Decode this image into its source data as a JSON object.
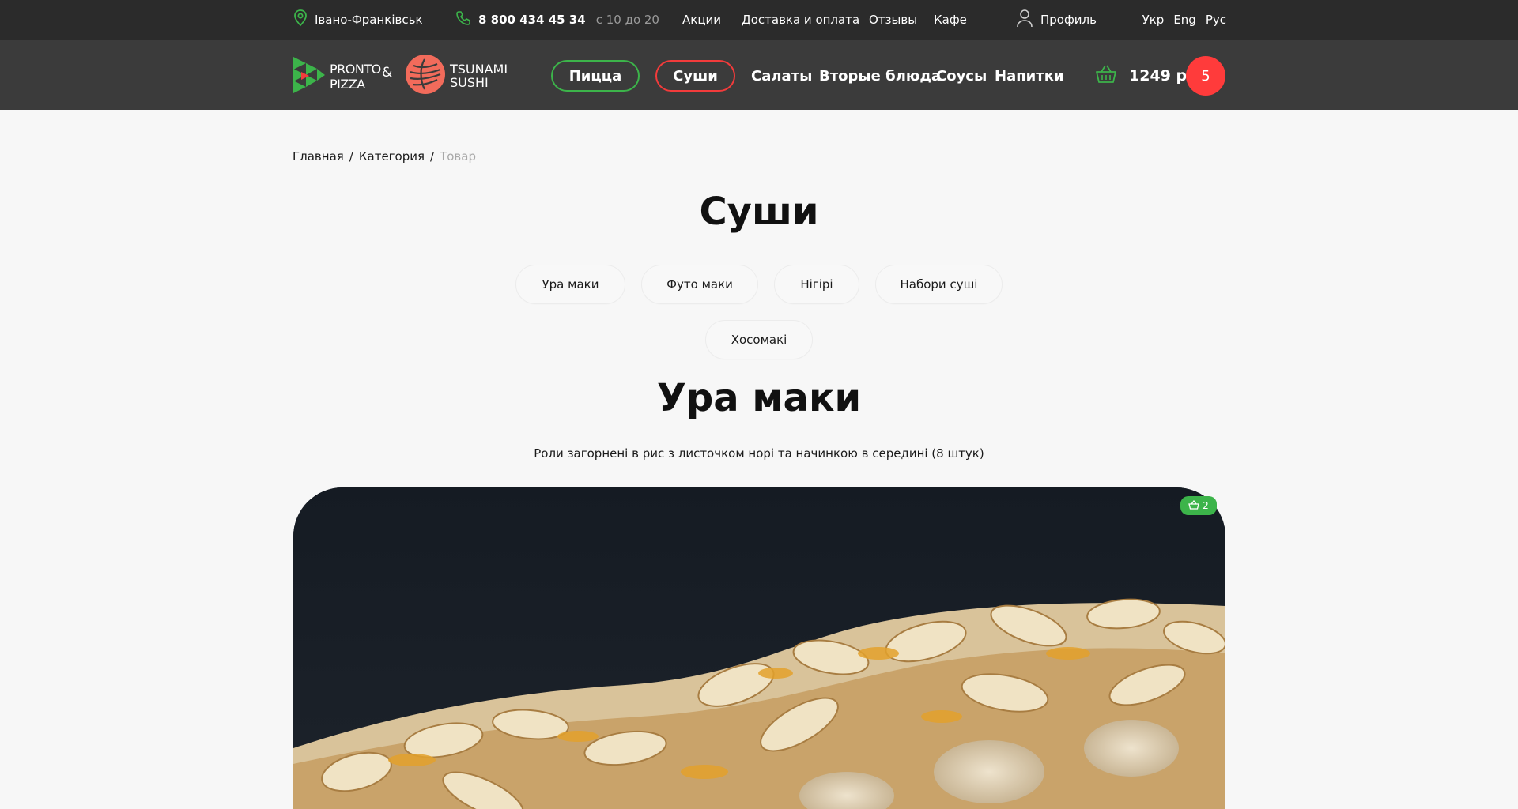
{
  "topbar": {
    "city": "Івано-Франківськ",
    "phone": "8 800 434 45 34",
    "hours": "с 10 до 20",
    "links": [
      "Акции",
      "Доставка и оплата",
      "Отзывы",
      "Кафе"
    ],
    "profile": "Профиль",
    "languages": [
      "Укр",
      "Eng",
      "Рус"
    ]
  },
  "header": {
    "pronto_line1": "PRONTO",
    "pronto_line2": "PIZZA",
    "ampersand": "&",
    "tsunami_line1": "TSUNAMI",
    "tsunami_line2": "SUSHI",
    "nav": {
      "pizza": "Пицца",
      "sushi": "Суши",
      "salads": "Салаты",
      "mains": "Вторые блюда",
      "sauces": "Соусы",
      "drinks": "Напитки"
    },
    "cart_total": "1249 р",
    "cart_count": "5"
  },
  "breadcrumb": {
    "home": "Главная",
    "category": "Категория",
    "current": "Товар",
    "separator": "/"
  },
  "page_title": "Суши",
  "subcategories": [
    "Ура маки",
    "Футо маки",
    "Нігірі",
    "Набори суші",
    "Хосомакі"
  ],
  "product": {
    "title": "Ура маки",
    "description": "Роли загорнені в рис з листочком норі та начинкою в середині (8 штук)",
    "badge_count": "2"
  },
  "colors": {
    "green": "#3cb44a",
    "red": "#f23b3b",
    "topbar_bg": "#2b2b2b",
    "header_bg": "#3b3b3b",
    "salmon": "#f26b5b"
  }
}
